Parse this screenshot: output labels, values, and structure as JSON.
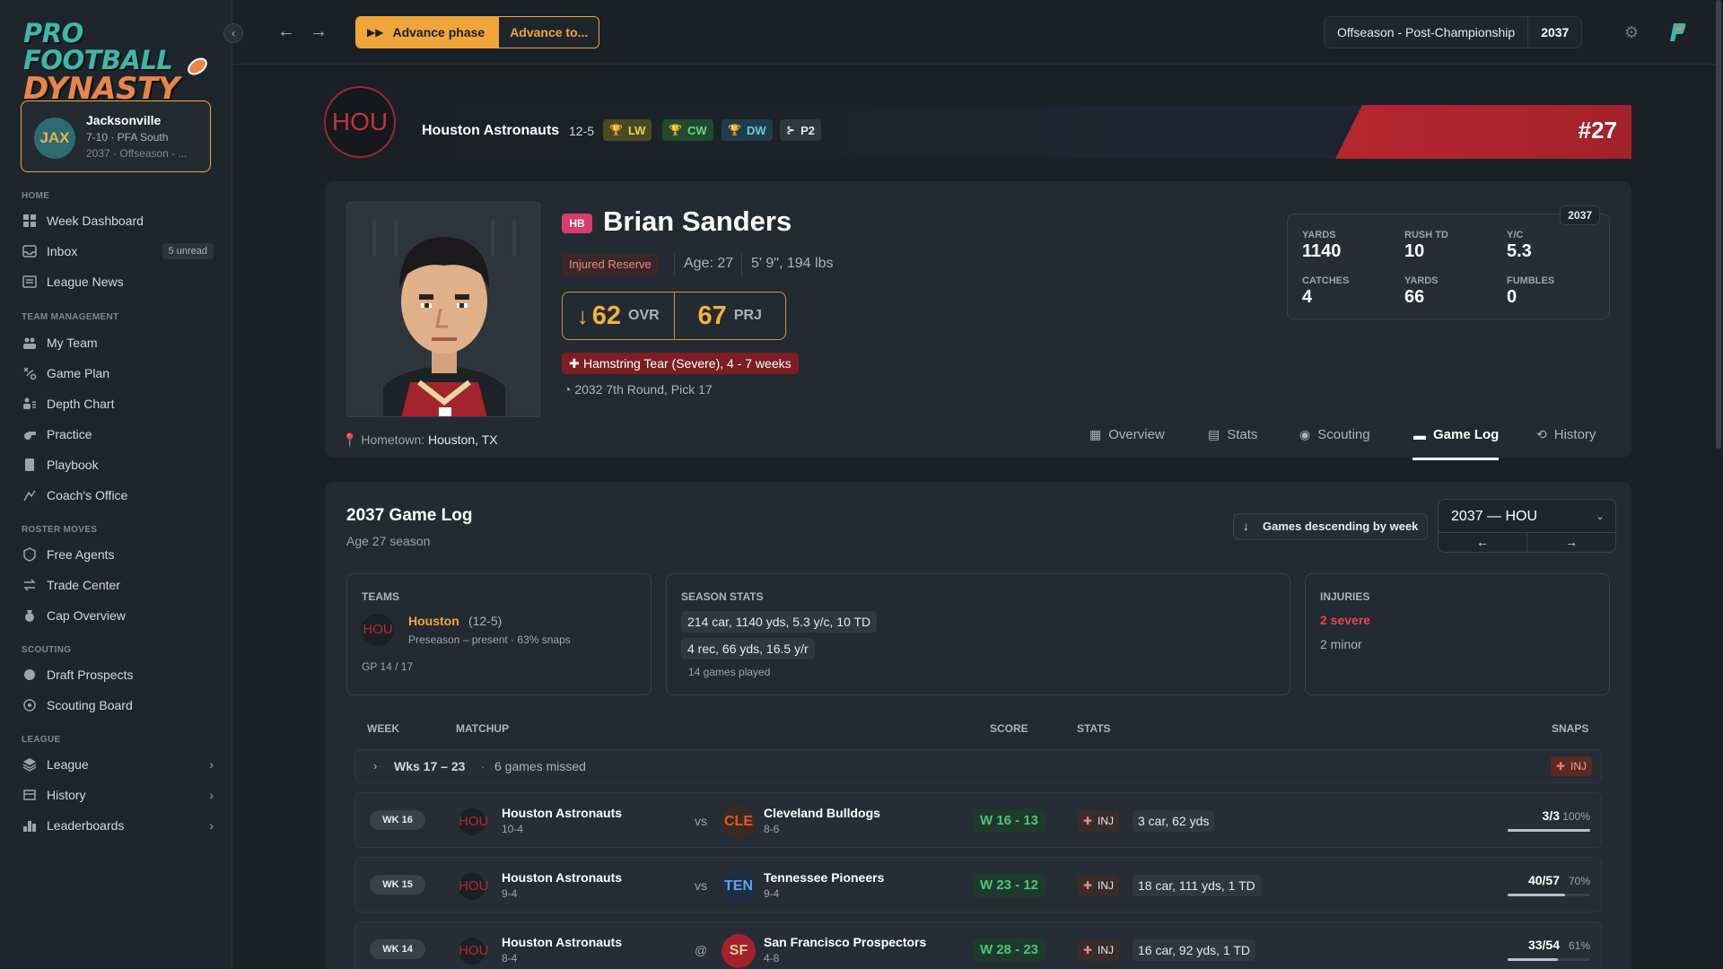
{
  "app": {
    "logo_line1": "PRO FOOTBALL",
    "logo_line2": "DYNASTY"
  },
  "user_team": {
    "abbr": "JAX",
    "name": "Jacksonville",
    "record": "7-10 · PFA South",
    "sub": "2037 · Offseason - ..."
  },
  "sidebar": {
    "sections": [
      {
        "label": "HOME"
      },
      {
        "label": "TEAM MANAGEMENT"
      },
      {
        "label": "ROSTER MOVES"
      },
      {
        "label": "SCOUTING"
      },
      {
        "label": "LEAGUE"
      }
    ],
    "items": [
      {
        "label": "Week Dashboard",
        "icon": "dashboard-icon"
      },
      {
        "label": "Inbox",
        "icon": "inbox-icon",
        "badge": "5 unread"
      },
      {
        "label": "League News",
        "icon": "news-icon"
      },
      {
        "label": "My Team",
        "icon": "team-icon"
      },
      {
        "label": "Game Plan",
        "icon": "play-icon"
      },
      {
        "label": "Depth Chart",
        "icon": "depth-icon"
      },
      {
        "label": "Practice",
        "icon": "whistle-icon"
      },
      {
        "label": "Playbook",
        "icon": "book-icon"
      },
      {
        "label": "Coach's Office",
        "icon": "office-icon"
      },
      {
        "label": "Free Agents",
        "icon": "agents-icon"
      },
      {
        "label": "Trade Center",
        "icon": "trade-icon"
      },
      {
        "label": "Cap Overview",
        "icon": "money-icon"
      },
      {
        "label": "Draft Prospects",
        "icon": "draft-icon"
      },
      {
        "label": "Scouting Board",
        "icon": "eye-icon"
      },
      {
        "label": "League",
        "icon": "layers-icon"
      },
      {
        "label": "History",
        "icon": "history-icon"
      },
      {
        "label": "Leaderboards",
        "icon": "leaderboard-icon"
      }
    ]
  },
  "topbar": {
    "advance_label": "Advance phase",
    "advance_to_label": "Advance to...",
    "phase": "Offseason - Post-Championship",
    "year": "2037"
  },
  "team_banner": {
    "abbr": "HOU",
    "name": "Houston Astronauts",
    "record": "12-5",
    "achievements": [
      {
        "label": "LW",
        "icon": "trophy-icon"
      },
      {
        "label": "CW",
        "icon": "trophy-icon"
      },
      {
        "label": "DW",
        "icon": "trophy-icon"
      },
      {
        "label": "P2",
        "icon": "playoff-icon"
      }
    ],
    "number": "#27"
  },
  "player": {
    "position": "HB",
    "name": "Brian Sanders",
    "status": "Injured Reserve",
    "age": "Age: 27",
    "size": "5' 9\", 194 lbs",
    "ovr": "62",
    "ovr_label": "OVR",
    "prj": "67",
    "prj_label": "PRJ",
    "injury": "Hamstring Tear (Severe), 4 - 7 weeks",
    "draft": "2032 7th Round, Pick 17",
    "hometown_label": "Hometown:",
    "hometown": "Houston, TX"
  },
  "season_stats_box": {
    "year": "2037",
    "stats": [
      {
        "label": "YARDS",
        "value": "1140"
      },
      {
        "label": "RUSH TD",
        "value": "10"
      },
      {
        "label": "Y/C",
        "value": "5.3"
      },
      {
        "label": "CATCHES",
        "value": "4"
      },
      {
        "label": "YARDS",
        "value": "66"
      },
      {
        "label": "FUMBLES",
        "value": "0"
      }
    ]
  },
  "player_tabs": [
    {
      "label": "Overview",
      "icon": "grid-icon"
    },
    {
      "label": "Stats",
      "icon": "chart-icon"
    },
    {
      "label": "Scouting",
      "icon": "eye-icon"
    },
    {
      "label": "Game Log",
      "icon": "calendar-icon",
      "active": true
    },
    {
      "label": "History",
      "icon": "history-icon"
    }
  ],
  "game_log": {
    "title": "2037 Game Log",
    "subtitle": "Age 27 season",
    "sort_label": "Games descending by week",
    "season_select": "2037 — HOU",
    "teams_label": "TEAMS",
    "team_abbr": "HOU",
    "team_name": "Houston",
    "team_record": "(12-5)",
    "team_tenure": "Preseason – present · 63% snaps",
    "gp": "GP 14 / 17",
    "season_stats_label": "SEASON STATS",
    "season_rush": "214 car, 1140 yds, 5.3 y/c, 10 TD",
    "season_rec": "4 rec, 66 yds, 16.5 y/r",
    "games_played": "14 games played",
    "injuries_label": "INJURIES",
    "injuries_severe": "2 severe",
    "injuries_minor": "2 minor",
    "columns": {
      "week": "WEEK",
      "matchup": "MATCHUP",
      "score": "SCORE",
      "stats": "STATS",
      "snaps": "SNAPS"
    },
    "missed": {
      "weeks": "Wks 17 – 23",
      "games": "6 games missed",
      "badge": "INJ"
    },
    "rows": [
      {
        "week": "WK 16",
        "team": "Houston Astronauts",
        "team_rec": "10-4",
        "site": "vs",
        "opp_abbr": "CLE",
        "opp": "Cleveland Bulldogs",
        "opp_rec": "8-6",
        "score": "W 16 - 13",
        "inj": "INJ",
        "stats": "3 car, 62 yds",
        "snaps": "3/3",
        "pct": "100%",
        "pct_value": 1.0
      },
      {
        "week": "WK 15",
        "team": "Houston Astronauts",
        "team_rec": "9-4",
        "site": "vs",
        "opp_abbr": "TEN",
        "opp": "Tennessee Pioneers",
        "opp_rec": "9-4",
        "score": "W 23 - 12",
        "inj": "INJ",
        "stats": "18 car, 111 yds, 1 TD",
        "snaps": "40/57",
        "pct": "70%",
        "pct_value": 0.7
      },
      {
        "week": "WK 14",
        "team": "Houston Astronauts",
        "team_rec": "8-4",
        "site": "@",
        "opp_abbr": "SF",
        "opp": "San Francisco Prospectors",
        "opp_rec": "4-8",
        "score": "W 28 - 23",
        "inj": "INJ",
        "stats": "16 car, 92 yds, 1 TD",
        "snaps": "33/54",
        "pct": "61%",
        "pct_value": 0.61
      }
    ]
  },
  "colors": {
    "accent": "#f0a63a",
    "houston_red": "#b7262f",
    "win_green": "#4cc47e",
    "jax_teal": "#2c6b70"
  }
}
